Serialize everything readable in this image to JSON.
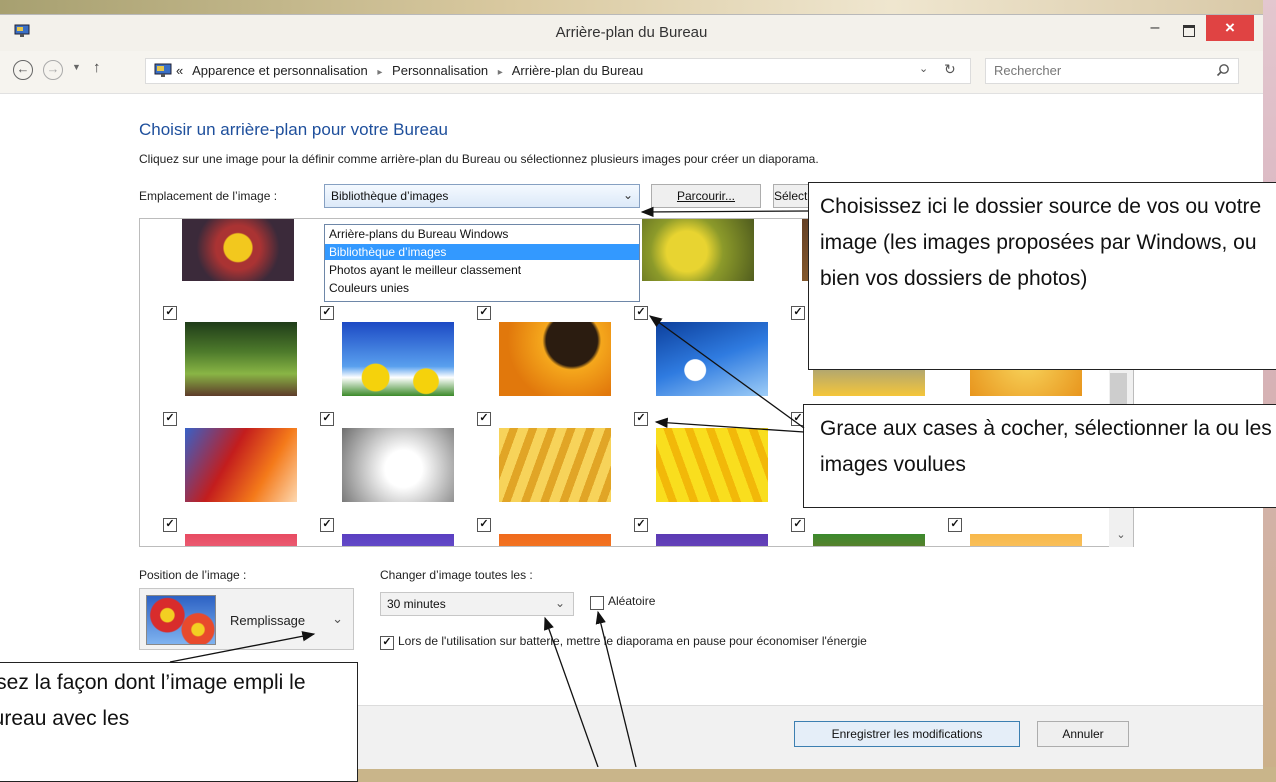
{
  "window": {
    "title": "Arrière-plan du Bureau",
    "minimize_label": "–",
    "close_label": "×"
  },
  "navigation": {
    "breadcrumb_root": "«",
    "breadcrumb": [
      "Apparence et personnalisation",
      "Personnalisation",
      "Arrière-plan du Bureau"
    ],
    "separator": "▸",
    "search_placeholder": "Rechercher"
  },
  "main": {
    "heading": "Choisir un arrière-plan pour votre Bureau",
    "description": "Cliquez sur une image pour la définir comme arrière-plan du Bureau ou sélectionnez plusieurs images pour créer un diaporama.",
    "location_label": "Emplacement de l’image :",
    "location_selected": "Bibliothèque d’images",
    "location_options": [
      "Arrière-plans du Bureau Windows",
      "Bibliothèque d’images",
      "Photos ayant le meilleur classement",
      "Couleurs unies"
    ],
    "browse_label": "Parcourir...",
    "select_all_label": "Sélectionner tout"
  },
  "thumbnail_rows": [
    {
      "checked": [
        false,
        false,
        false,
        false,
        false,
        false
      ]
    },
    {
      "checked": [
        true,
        true,
        true,
        true,
        true,
        true
      ]
    },
    {
      "checked": [
        true,
        true,
        true,
        true,
        true,
        true
      ]
    },
    {
      "checked": [
        true,
        true,
        true,
        true,
        true,
        true
      ]
    }
  ],
  "position": {
    "label": "Position de l’image :",
    "value": "Remplissage"
  },
  "slideshow": {
    "label": "Changer d’image toutes les :",
    "interval": "30 minutes",
    "random_label": "Aléatoire",
    "random_checked": false,
    "battery_label": "Lors de l'utilisation sur batterie, mettre le diaporama en pause pour économiser l'énergie",
    "battery_checked": true
  },
  "footer": {
    "save_label": "Enregistrer les modifications",
    "cancel_label": "Annuler"
  },
  "annotations": {
    "callout_source": "Choisissez ici le dossier source de vos ou votre image (les images proposées par Windows, ou bien vos dossiers de photos)",
    "callout_checkboxes": "Grace aux cases à cocher, sélectionner la ou les images voulues",
    "callout_position": "issez la façon dont l’image empli le bureau avec les"
  },
  "colors": {
    "close_button": "#e04343",
    "heading": "#1e4f9c",
    "selected_option": "#3399ff"
  }
}
